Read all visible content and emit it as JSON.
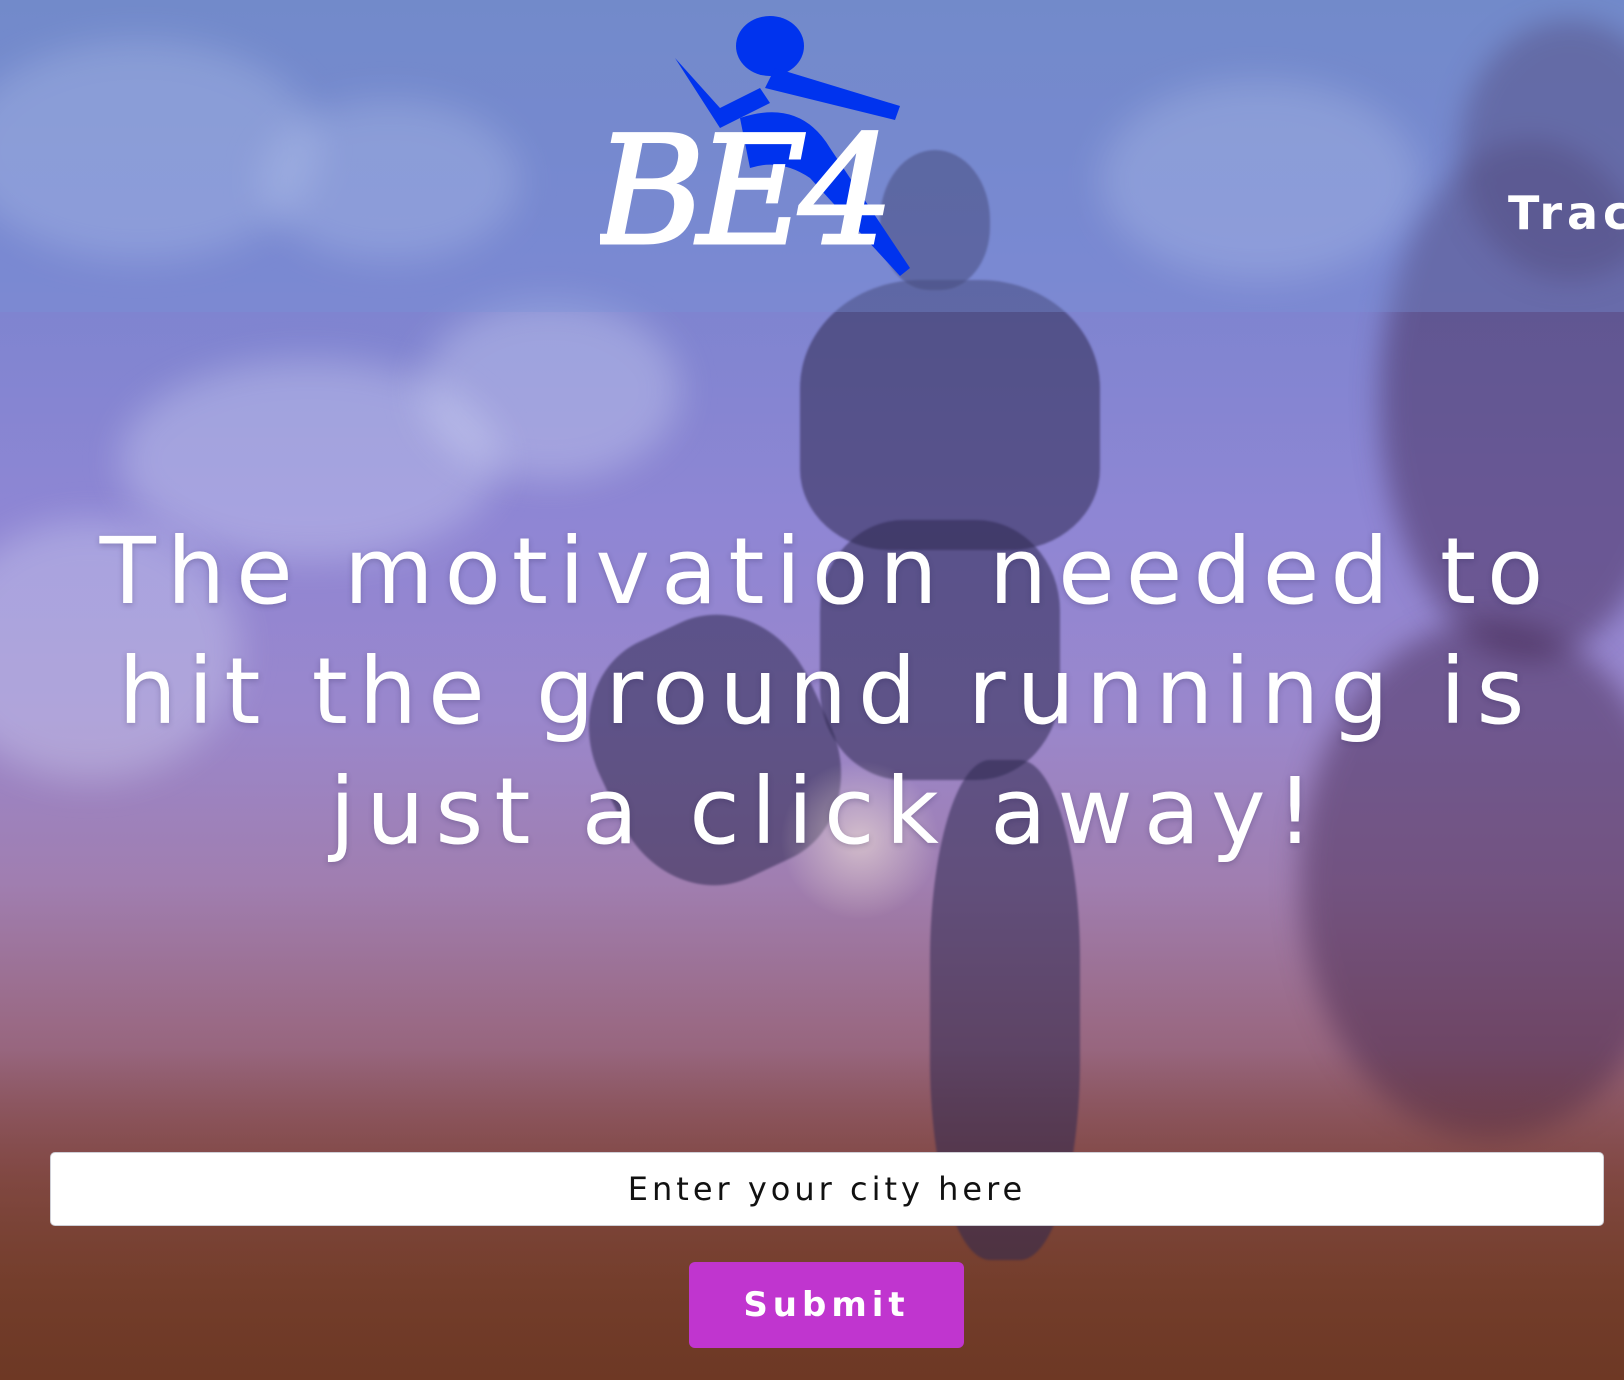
{
  "brand": {
    "logo_text": "BE4",
    "logo_color": "#0033ee"
  },
  "nav": {
    "partial_item": "Trac"
  },
  "hero": {
    "heading": "The motivation needed to hit the ground running is just a click away!"
  },
  "search": {
    "placeholder": "Enter your city here"
  },
  "actions": {
    "submit_label": "Submit"
  },
  "colors": {
    "accent": "#c035cf",
    "header_overlay": "#7891d7"
  },
  "background": {
    "subject": "runner-on-dirt-trail-photo"
  }
}
